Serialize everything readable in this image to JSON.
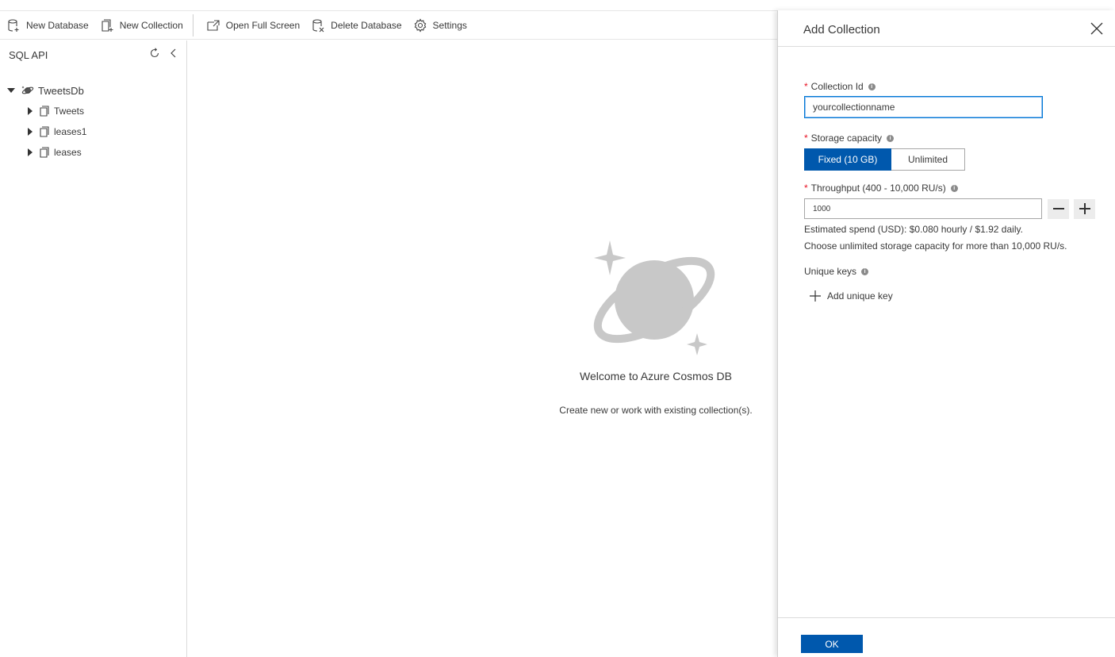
{
  "toolbar": {
    "new_database": "New Database",
    "new_collection": "New Collection",
    "open_full_screen": "Open Full Screen",
    "delete_database": "Delete Database",
    "settings": "Settings"
  },
  "sidebar": {
    "title": "SQL API",
    "database": "TweetsDb",
    "collections": [
      "Tweets",
      "leases1",
      "leases"
    ]
  },
  "welcome": {
    "title": "Welcome to Azure Cosmos DB",
    "subtitle": "Create new or work with existing collection(s)."
  },
  "panel": {
    "title": "Add Collection",
    "collection_id_label": "Collection Id",
    "collection_id_value": "yourcollectionname",
    "storage_label": "Storage capacity",
    "storage_options": [
      "Fixed (10 GB)",
      "Unlimited"
    ],
    "storage_selected": "Fixed (10 GB)",
    "throughput_label": "Throughput (400 - 10,000 RU/s)",
    "throughput_value": "1000",
    "estimate_note": "Estimated spend (USD): $0.080 hourly / $1.92 daily.",
    "unlimited_note": "Choose unlimited storage capacity for more than 10,000 RU/s.",
    "unique_keys_label": "Unique keys",
    "add_unique_key": "Add unique key",
    "ok": "OK"
  },
  "colors": {
    "accent": "#0058ad",
    "required": "#e81123"
  },
  "icons": {
    "new_database": "database-add-icon",
    "new_collection": "collection-add-icon",
    "open_full_screen": "external-open-icon",
    "delete_database": "database-delete-icon",
    "settings": "gear-icon",
    "refresh": "refresh-icon",
    "collapse": "chevron-left-icon",
    "close": "close-icon"
  }
}
